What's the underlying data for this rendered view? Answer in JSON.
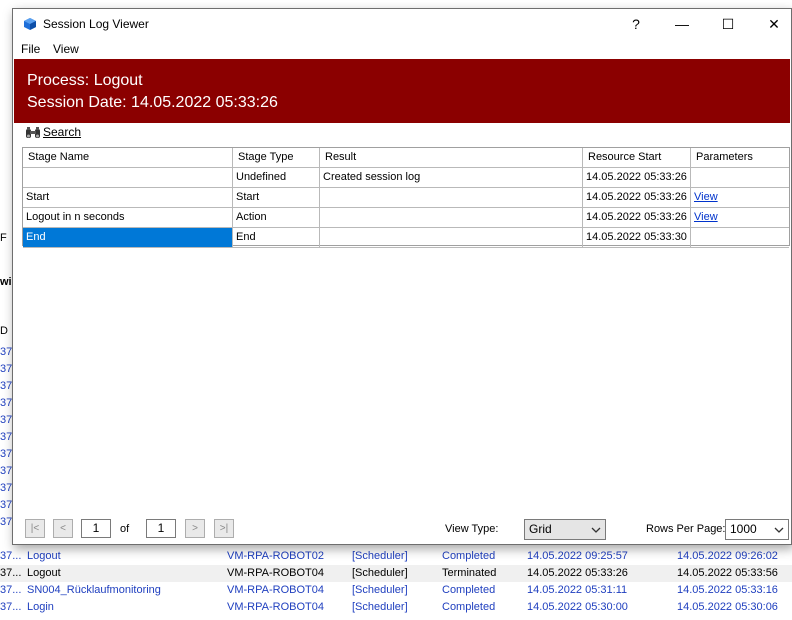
{
  "window": {
    "title": "Session Log Viewer",
    "help": "?",
    "minimize": "—",
    "maximize": "☐",
    "close": "✕"
  },
  "menu": {
    "file": "File",
    "view": "View"
  },
  "banner": {
    "process": "Process: Logout",
    "session_date": "Session Date: 14.05.2022 05:33:26",
    "color": "#8b0000"
  },
  "search": {
    "label": "Search"
  },
  "grid": {
    "headers": [
      "Stage Name",
      "Stage Type",
      "Result",
      "Resource Start",
      "Parameters"
    ],
    "rows": [
      [
        "",
        "Undefined",
        "Created session log",
        "14.05.2022 05:33:26",
        ""
      ],
      [
        "Start",
        "Start",
        "",
        "14.05.2022 05:33:26",
        "View"
      ],
      [
        "Logout in n seconds",
        "Action",
        "",
        "14.05.2022 05:33:26",
        "View"
      ],
      [
        "End",
        "End",
        "",
        "14.05.2022 05:33:30",
        ""
      ]
    ]
  },
  "pager": {
    "first": "|<",
    "prev": "<",
    "page": "1",
    "of": "of",
    "total": "1",
    "next": ">",
    "last": ">|",
    "view_type_label": "View Type:",
    "view_type": "Grid",
    "rows_per_page_label": "Rows Per Page:",
    "rows_per_page": "1000"
  },
  "background": {
    "left_strip": [
      "F",
      "wi",
      "D",
      "37.",
      "37.",
      "37.",
      "37.",
      "37.",
      "37.",
      "37.",
      "37.",
      "37.",
      "37.",
      "37."
    ],
    "rows": [
      [
        "37...",
        "Logout",
        "VM-RPA-ROBOT02",
        "[Scheduler]",
        "Completed",
        "14.05.2022 09:25:57",
        "14.05.2022 09:26:02"
      ],
      [
        "37...",
        "Logout",
        "VM-RPA-ROBOT04",
        "[Scheduler]",
        "Terminated",
        "14.05.2022 05:33:26",
        "14.05.2022 05:33:56"
      ],
      [
        "37...",
        "SN004_Rücklaufmonitoring",
        "VM-RPA-ROBOT04",
        "[Scheduler]",
        "Completed",
        "14.05.2022 05:31:11",
        "14.05.2022 05:33:16"
      ],
      [
        "37...",
        "Login",
        "VM-RPA-ROBOT04",
        "[Scheduler]",
        "Completed",
        "14.05.2022 05:30:00",
        "14.05.2022 05:30:06"
      ]
    ]
  }
}
